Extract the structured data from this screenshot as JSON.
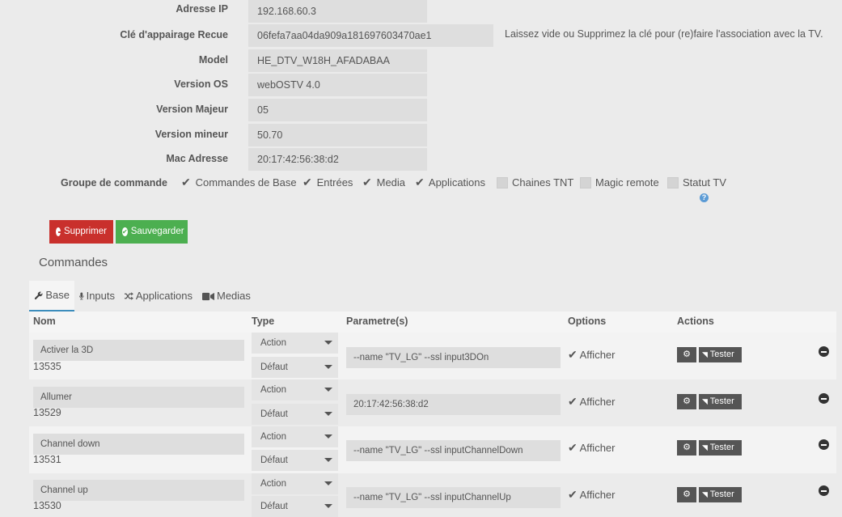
{
  "fields": [
    {
      "label": "Adresse IP",
      "value": "192.168.60.3"
    },
    {
      "label": "Clé d'appairage Recue",
      "value": "06fefa7aa04da909a181697603470ae1"
    },
    {
      "label": "Model",
      "value": "HE_DTV_W18H_AFADABAA"
    },
    {
      "label": "Version OS",
      "value": "webOSTV 4.0"
    },
    {
      "label": "Version Majeur",
      "value": "05"
    },
    {
      "label": "Version mineur",
      "value": "50.70"
    },
    {
      "label": "Mac Adresse",
      "value": "20:17:42:56:38:d2"
    }
  ],
  "pairing_hint": "Laissez vide ou Supprimez la clé pour (re)faire l'association avec la TV.",
  "groupe": {
    "label": "Groupe de commande",
    "options": [
      {
        "label": "Commandes de Base",
        "checked": true
      },
      {
        "label": "Entrées",
        "checked": true
      },
      {
        "label": "Media",
        "checked": true
      },
      {
        "label": "Applications",
        "checked": true
      },
      {
        "label": "Chaines TNT",
        "checked": false
      },
      {
        "label": "Magic remote",
        "checked": false
      },
      {
        "label": "Statut TV",
        "checked": false
      }
    ]
  },
  "buttons": {
    "delete": "Supprimer",
    "save": "Sauvegarder"
  },
  "section_title": "Commandes",
  "tabs": [
    {
      "label": "Base",
      "icon": "wrench-icon",
      "active": true
    },
    {
      "label": "Inputs",
      "icon": "microphone-icon",
      "active": false
    },
    {
      "label": "Applications",
      "icon": "shuffle-icon",
      "active": false
    },
    {
      "label": "Medias",
      "icon": "video-camera-icon",
      "active": false
    }
  ],
  "table": {
    "headers": {
      "nom": "Nom",
      "type": "Type",
      "params": "Parametre(s)",
      "options": "Options",
      "actions": "Actions"
    },
    "rows": [
      {
        "name": "Activer la 3D",
        "id": "13535",
        "type1": "Action",
        "type2": "Défaut",
        "param": "--name \"TV_LG\" --ssl input3DOn",
        "option": "Afficher",
        "test": "Tester"
      },
      {
        "name": "Allumer",
        "id": "13529",
        "type1": "Action",
        "type2": "Défaut",
        "param": "20:17:42:56:38:d2",
        "option": "Afficher",
        "test": "Tester"
      },
      {
        "name": "Channel down",
        "id": "13531",
        "type1": "Action",
        "type2": "Défaut",
        "param": "--name \"TV_LG\" --ssl inputChannelDown",
        "option": "Afficher",
        "test": "Tester"
      },
      {
        "name": "Channel up",
        "id": "13530",
        "type1": "Action",
        "type2": "Défaut",
        "param": "--name \"TV_LG\" --ssl inputChannelUp",
        "option": "Afficher",
        "test": "Tester"
      }
    ]
  },
  "colors": {
    "danger": "#c9302c",
    "success": "#4caf50",
    "accent": "#3c8dbc"
  }
}
